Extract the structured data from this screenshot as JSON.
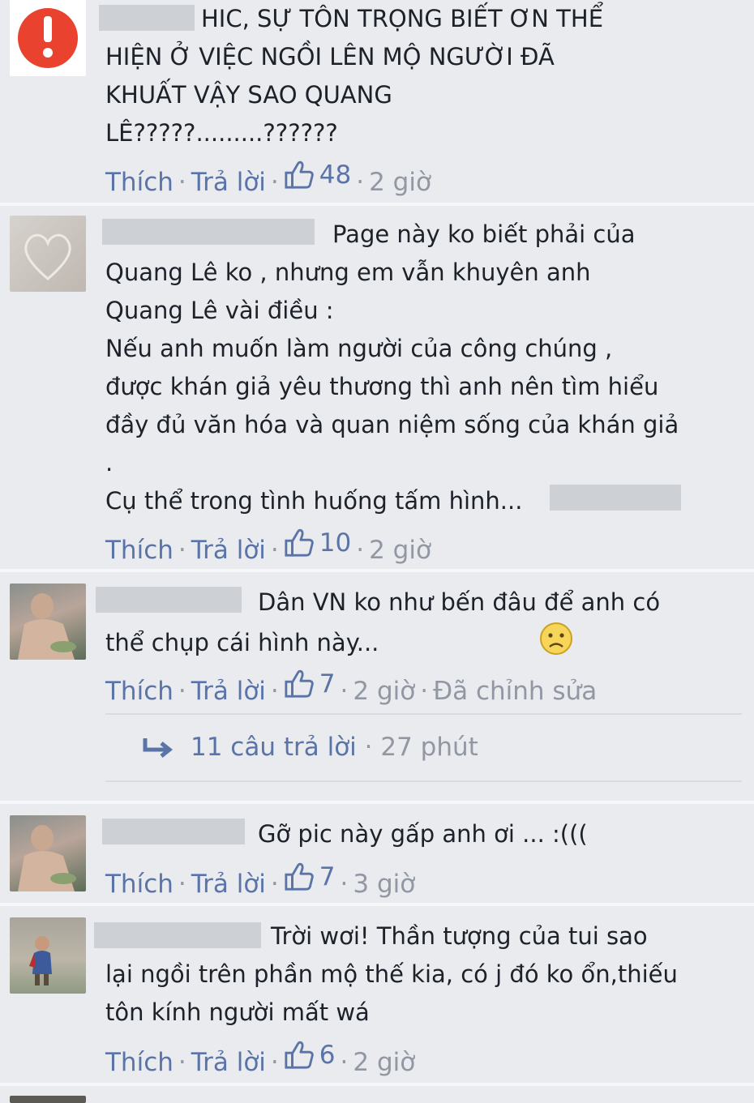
{
  "comments": [
    {
      "text": "HIC, SỰ TÔN TRỌNG BIẾT ƠN THỂ\nHIỆN Ở VIỆC NGỒI LÊN MỘ NGƯỜI ĐÃ\nKHUẤT VẬY SAO QUANG\nLÊ?????.........??????",
      "like_label": "Thích",
      "reply_label": "Trả lời",
      "likes": "48",
      "time": "2 giờ",
      "avatar": "warning-icon"
    },
    {
      "text": "Page này ko biết phải của\nQuang Lê ko , nhưng em vẫn khuyên anh\nQuang Lê vài điều :\nNếu anh muốn làm người của công chúng ,\nđược khán giả yêu thương thì anh nên tìm hiểu\nđầy đủ văn hóa và quan niệm sống của khán giả\n.\nCụ thể trong tình huống tấm hình...",
      "like_label": "Thích",
      "reply_label": "Trả lời",
      "likes": "10",
      "time": "2 giờ",
      "avatar": "heart-sand-photo"
    },
    {
      "text": "Dân VN ko như bến đâu để anh có\nthể chụp cái hình này...",
      "like_label": "Thích",
      "reply_label": "Trả lời",
      "likes": "7",
      "time": "2 giờ",
      "edited": "Đã chỉnh sửa",
      "replies_label": "11 câu trả lời",
      "replies_time": "27 phút",
      "avatar": "man-photo"
    },
    {
      "text": "Gỡ pic này gấp anh ơi ... :(((",
      "like_label": "Thích",
      "reply_label": "Trả lời",
      "likes": "7",
      "time": "3 giờ",
      "avatar": "man-photo"
    },
    {
      "text": "Trời wơi! Thần tượng của tui sao\nlại ngồi trên phần mộ thế kia, có j đó ko ổn,thiếu\ntôn kính người mất wá",
      "like_label": "Thích",
      "reply_label": "Trả lời",
      "likes": "6",
      "time": "2 giờ",
      "avatar": "child-photo"
    }
  ],
  "colors": {
    "background": "#e9ebee",
    "link": "#5b74a8",
    "meta": "#9197a3",
    "warning": "#e9422e"
  }
}
